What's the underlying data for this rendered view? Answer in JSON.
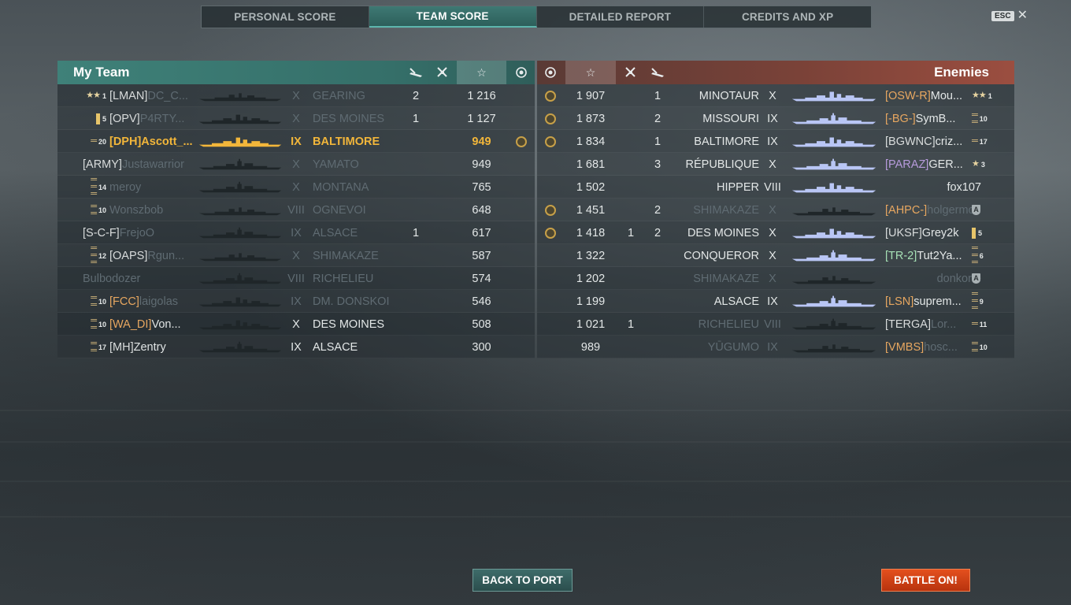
{
  "tabs": [
    "PERSONAL SCORE",
    "TEAM SCORE",
    "DETAILED REPORT",
    "CREDITS AND XP"
  ],
  "active_tab": 1,
  "esc_label": "ESC",
  "close_glyph": "✕",
  "my_team": {
    "title": "My Team",
    "header_icons": [
      "torpedo-icon",
      "planes-icon",
      "star-icon",
      "medal-icon"
    ],
    "rows": [
      {
        "rank": "1",
        "rank_icon": "stars",
        "clan": "[LMAN]",
        "clan_style": "w",
        "nick": "DC_C...",
        "tier": "X",
        "ship": "GEARING",
        "c1": "2",
        "c2": "",
        "score": "1 216",
        "medal": false,
        "me": false,
        "dead": true,
        "silhouette": "dd"
      },
      {
        "rank": "5",
        "rank_icon": "bar",
        "clan": "[OPV]",
        "clan_style": "w",
        "nick": "P4RTY...",
        "tier": "X",
        "ship": "DES MOINES",
        "c1": "1",
        "c2": "",
        "score": "1 127",
        "medal": false,
        "me": false,
        "dead": true,
        "silhouette": "ca"
      },
      {
        "rank": "20",
        "rank_icon": "chev1",
        "clan": "[DPH]",
        "clan_style": "w",
        "nick": "Ascott_...",
        "tier": "IX",
        "ship": "BALTIMORE",
        "c1": "",
        "c2": "",
        "score": "949",
        "medal": true,
        "me": true,
        "dead": false,
        "silhouette": "ca"
      },
      {
        "rank": "",
        "rank_icon": "",
        "clan": "[ARMY]",
        "clan_style": "w",
        "nick": "Justawarrior",
        "tier": "X",
        "ship": "YAMATO",
        "c1": "",
        "c2": "",
        "score": "949",
        "medal": false,
        "me": false,
        "dead": true,
        "silhouette": "bb"
      },
      {
        "rank": "14",
        "rank_icon": "chev3",
        "clan": "",
        "clan_style": "w",
        "nick": "meroy",
        "tier": "X",
        "ship": "MONTANA",
        "c1": "",
        "c2": "",
        "score": "765",
        "medal": false,
        "me": false,
        "dead": true,
        "silhouette": "bb"
      },
      {
        "rank": "10",
        "rank_icon": "chev2",
        "clan": "",
        "clan_style": "w",
        "nick": "Wonszbob",
        "tier": "VIII",
        "ship": "OGNEVOI",
        "c1": "",
        "c2": "",
        "score": "648",
        "medal": false,
        "me": false,
        "dead": true,
        "silhouette": "dd"
      },
      {
        "rank": "",
        "rank_icon": "",
        "clan": "[S-C-F]",
        "clan_style": "w",
        "nick": "FrejoO",
        "tier": "IX",
        "ship": "ALSACE",
        "c1": "1",
        "c2": "",
        "score": "617",
        "medal": false,
        "me": false,
        "dead": true,
        "silhouette": "bb"
      },
      {
        "rank": "12",
        "rank_icon": "chev3",
        "clan": "[OAPS]",
        "clan_style": "w",
        "nick": "Rgun...",
        "tier": "X",
        "ship": "SHIMAKAZE",
        "c1": "",
        "c2": "",
        "score": "587",
        "medal": false,
        "me": false,
        "dead": true,
        "silhouette": "dd"
      },
      {
        "rank": "",
        "rank_icon": "",
        "clan": "",
        "clan_style": "w",
        "nick": "Bulbodozer",
        "tier": "VIII",
        "ship": "RICHELIEU",
        "c1": "",
        "c2": "",
        "score": "574",
        "medal": false,
        "me": false,
        "dead": true,
        "silhouette": "bb"
      },
      {
        "rank": "10",
        "rank_icon": "chev2",
        "clan": "[FCC]",
        "clan_style": "o",
        "nick": "laigolas",
        "tier": "IX",
        "ship": "DM. DONSKOI",
        "c1": "",
        "c2": "",
        "score": "546",
        "medal": false,
        "me": false,
        "dead": true,
        "silhouette": "ca"
      },
      {
        "rank": "10",
        "rank_icon": "chev2",
        "clan": "[WA_DI]",
        "clan_style": "o",
        "nick": "Von...",
        "tier": "X",
        "ship": "DES MOINES",
        "c1": "",
        "c2": "",
        "score": "508",
        "medal": false,
        "me": false,
        "dead": false,
        "silhouette": "ca"
      },
      {
        "rank": "17",
        "rank_icon": "chev2",
        "clan": "[MH]",
        "clan_style": "w",
        "nick": "Zentry",
        "tier": "IX",
        "ship": "ALSACE",
        "c1": "",
        "c2": "",
        "score": "300",
        "medal": false,
        "me": false,
        "dead": false,
        "silhouette": "bb"
      }
    ]
  },
  "enemies": {
    "title": "Enemies",
    "header_icons": [
      "medal-icon",
      "star-icon",
      "planes-icon",
      "torpedo-icon"
    ],
    "rows": [
      {
        "medal": true,
        "score": "1 907",
        "c2": "",
        "c1": "1",
        "ship": "MINOTAUR",
        "tier": "X",
        "clan": "[OSW-R]",
        "clan_style": "o",
        "nick": "Mou...",
        "rank": "1",
        "rank_icon": "stars",
        "dead": false,
        "silhouette": "ca"
      },
      {
        "medal": true,
        "score": "1 873",
        "c2": "",
        "c1": "2",
        "ship": "MISSOURI",
        "tier": "IX",
        "clan": "[-BG-]",
        "clan_style": "o",
        "nick": "SymB...",
        "rank": "10",
        "rank_icon": "chev2",
        "dead": false,
        "silhouette": "bb"
      },
      {
        "medal": true,
        "score": "1 834",
        "c2": "",
        "c1": "1",
        "ship": "BALTIMORE",
        "tier": "IX",
        "clan": "[BGWNC]",
        "clan_style": "w",
        "nick": "criz...",
        "rank": "17",
        "rank_icon": "chev1",
        "dead": false,
        "silhouette": "ca"
      },
      {
        "medal": false,
        "score": "1 681",
        "c2": "",
        "c1": "3",
        "ship": "RÉPUBLIQUE",
        "tier": "X",
        "clan": "[PARAZ]",
        "clan_style": "p",
        "nick": "GER...",
        "rank": "3",
        "rank_icon": "star",
        "dead": false,
        "silhouette": "bb"
      },
      {
        "medal": false,
        "score": "1 502",
        "c2": "",
        "c1": "",
        "ship": "HIPPER",
        "tier": "VIII",
        "clan": "",
        "clan_style": "w",
        "nick": "fox107",
        "rank": "",
        "rank_icon": "",
        "dead": false,
        "silhouette": "ca"
      },
      {
        "medal": true,
        "score": "1 451",
        "c2": "",
        "c1": "2",
        "ship": "SHIMAKAZE",
        "tier": "X",
        "clan": "[AHPC-]",
        "clan_style": "o",
        "nick": "holgermoe...",
        "rank": "",
        "rank_icon": "shield",
        "dead": true,
        "silhouette": "dd"
      },
      {
        "medal": true,
        "score": "1 418",
        "c2": "1",
        "c1": "2",
        "ship": "DES MOINES",
        "tier": "X",
        "clan": "[UKSF]",
        "clan_style": "w",
        "nick": "Grey2k",
        "rank": "5",
        "rank_icon": "bar",
        "dead": false,
        "silhouette": "ca"
      },
      {
        "medal": false,
        "score": "1 322",
        "c2": "",
        "c1": "",
        "ship": "CONQUEROR",
        "tier": "X",
        "clan": "[TR-2]",
        "clan_style": "g",
        "nick": "Tut2Ya...",
        "rank": "6",
        "rank_icon": "chev3",
        "dead": false,
        "silhouette": "bb"
      },
      {
        "medal": false,
        "score": "1 202",
        "c2": "",
        "c1": "",
        "ship": "SHIMAKAZE",
        "tier": "X",
        "clan": "",
        "clan_style": "w",
        "nick": "donkorte",
        "rank": "",
        "rank_icon": "shield",
        "dead": true,
        "silhouette": "dd"
      },
      {
        "medal": false,
        "score": "1 199",
        "c2": "",
        "c1": "",
        "ship": "ALSACE",
        "tier": "IX",
        "clan": "[LSN]",
        "clan_style": "o",
        "nick": "suprem...",
        "rank": "9",
        "rank_icon": "chev3",
        "dead": false,
        "silhouette": "bb"
      },
      {
        "medal": false,
        "score": "1 021",
        "c2": "1",
        "c1": "",
        "ship": "RICHELIEU",
        "tier": "VIII",
        "clan": "[TERGA]",
        "clan_style": "w",
        "nick": "Lor...",
        "rank": "11",
        "rank_icon": "chev1",
        "dead": true,
        "silhouette": "bb"
      },
      {
        "medal": false,
        "score": "989",
        "c2": "",
        "c1": "",
        "ship": "YŪGUMO",
        "tier": "IX",
        "clan": "[VMBS]",
        "clan_style": "o",
        "nick": "hosc...",
        "rank": "10",
        "rank_icon": "chev2",
        "dead": true,
        "silhouette": "dd"
      }
    ]
  },
  "buttons": {
    "back": "BACK TO PORT",
    "battle": "BATTLE ON!"
  },
  "colors": {
    "my_team_header": "#3f8179",
    "enemy_header": "#9b4e40",
    "self_highlight": "#f2b63a",
    "alive_enemy_ship": "#b9c6f5",
    "battle_button": "#d9441a"
  }
}
